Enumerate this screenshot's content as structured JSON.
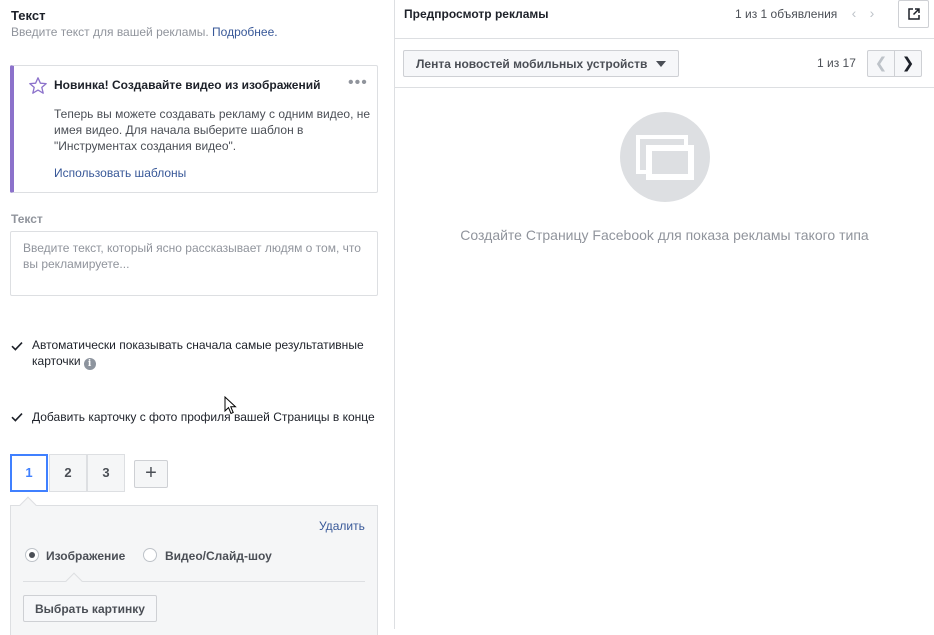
{
  "text_section": {
    "title": "Текст",
    "subtitle": "Введите текст для вашей рекламы.",
    "more_link": "Подробнее."
  },
  "promo": {
    "icon": "star-outline-icon",
    "title": "Новинка! Создавайте видео из изображений",
    "menu": "•••",
    "body": "Теперь вы можете создавать рекламу с одним видео, не имея видео. Для начала выберите шаблон в \"Инструментах создания видео\".",
    "link": "Использовать шаблоны",
    "accent_color": "#8c72cb"
  },
  "text_field": {
    "label": "Текст",
    "value": "",
    "placeholder": "Введите текст, который ясно рассказывает людям о том, что вы рекламируете..."
  },
  "options": {
    "auto_show": {
      "label": "Автоматически показывать сначала самые результативные карточки",
      "checked": true,
      "info_icon": "info-icon"
    },
    "add_profile_card": {
      "label": "Добавить карточку с фото профиля вашей Страницы в конце",
      "checked": true
    }
  },
  "cards": {
    "tabs": [
      "1",
      "2",
      "3"
    ],
    "active": "1",
    "add_icon": "plus-icon"
  },
  "card_panel": {
    "delete_label": "Удалить",
    "media_options": [
      {
        "label": "Изображение",
        "selected": true
      },
      {
        "label": "Видео/Слайд-шоу",
        "selected": false
      }
    ],
    "pick_image_label": "Выбрать картинку"
  },
  "preview": {
    "title": "Предпросмотр рекламы",
    "ads_count": "1 из 1 объявления",
    "external_icon": "external-link-icon",
    "placement": "Лента новостей мобильных устройств",
    "page_count": "1 из 17",
    "empty_message": "Создайте Страницу Facebook для показа рекламы такого типа",
    "placeholder_icon": "media-placeholder-icon"
  },
  "colors": {
    "link": "#385898",
    "active_tab": "#4080ff",
    "border": "#dddfe2"
  }
}
